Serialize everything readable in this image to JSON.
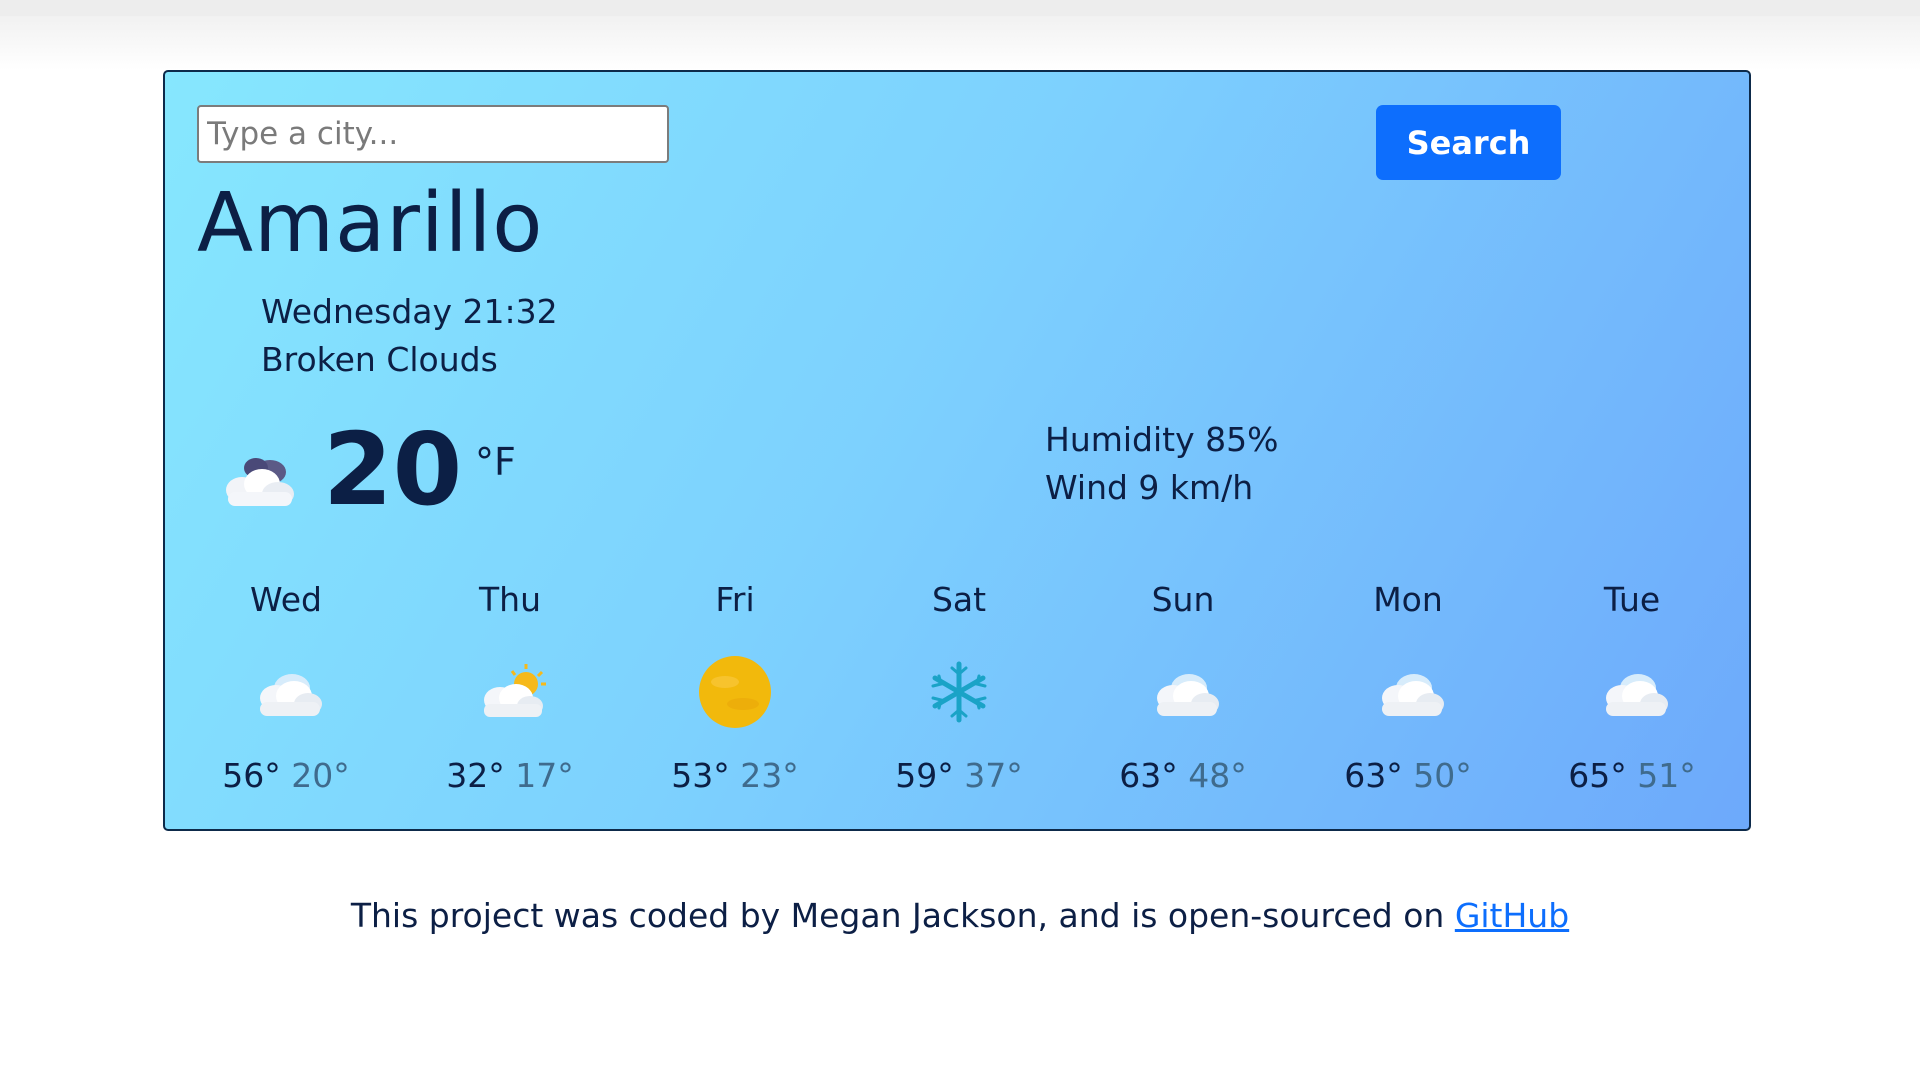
{
  "search": {
    "placeholder": "Type a city...",
    "button_label": "Search"
  },
  "current": {
    "city": "Amarillo",
    "datetime": "Wednesday 21:32",
    "description": "Broken Clouds",
    "icon": "night-cloud-icon",
    "temperature": "20",
    "unit": "°F",
    "humidity": "Humidity 85%",
    "wind": "Wind 9 km/h"
  },
  "forecast": [
    {
      "day": "Wed",
      "icon": "cloud-icon",
      "max": "56°",
      "min": "20°"
    },
    {
      "day": "Thu",
      "icon": "partly-sunny-icon",
      "max": "32°",
      "min": "17°"
    },
    {
      "day": "Fri",
      "icon": "sun-icon",
      "max": "53°",
      "min": "23°"
    },
    {
      "day": "Sat",
      "icon": "snowflake-icon",
      "max": "59°",
      "min": "37°"
    },
    {
      "day": "Sun",
      "icon": "cloud-icon",
      "max": "63°",
      "min": "48°"
    },
    {
      "day": "Mon",
      "icon": "cloud-icon",
      "max": "63°",
      "min": "50°"
    },
    {
      "day": "Tue",
      "icon": "cloud-icon",
      "max": "65°",
      "min": "51°"
    }
  ],
  "footer": {
    "text": "This project was coded by Megan Jackson, and is open-sourced on ",
    "link_label": "GitHub"
  },
  "colors": {
    "accent": "#0d6efd",
    "text": "#0c1f45",
    "card_gradient_start": "#86e7fe",
    "card_gradient_end": "#6da9fb"
  }
}
